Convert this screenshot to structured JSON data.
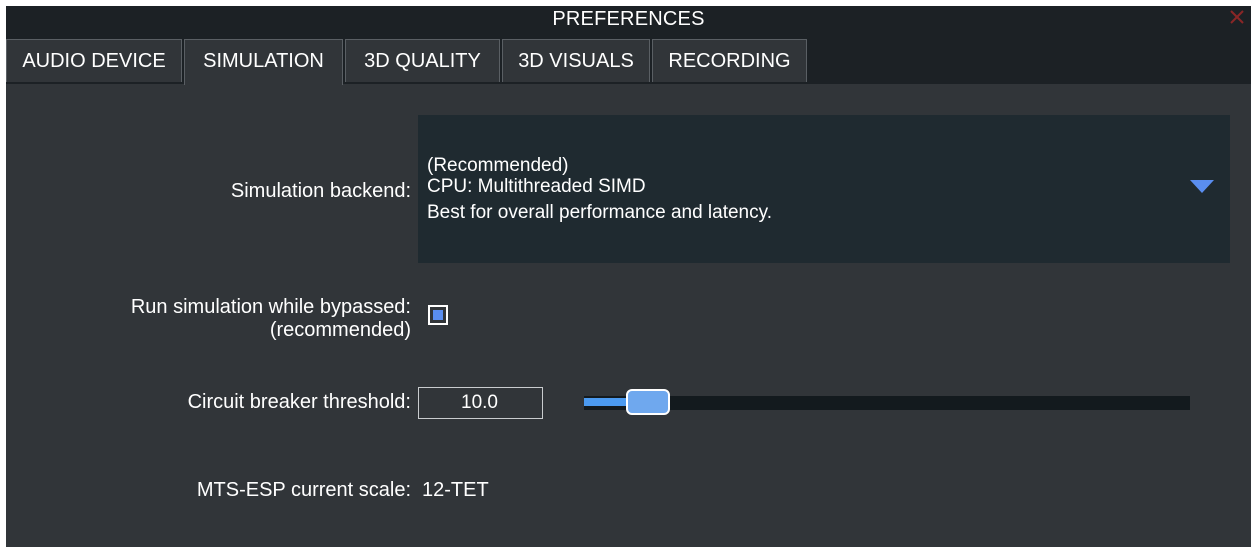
{
  "window": {
    "title": "PREFERENCES",
    "close_icon": "close-x-icon",
    "close_color": "#b02a2a"
  },
  "tabs": [
    {
      "label": "AUDIO DEVICE",
      "active": false
    },
    {
      "label": "SIMULATION",
      "active": true
    },
    {
      "label": "3D QUALITY",
      "active": false
    },
    {
      "label": "3D VISUALS",
      "active": false
    },
    {
      "label": "RECORDING",
      "active": false
    }
  ],
  "simulation": {
    "backend": {
      "label": "Simulation backend:",
      "selected_line1": "(Recommended)",
      "selected_line2": "CPU: Multithreaded SIMD",
      "selected_line3": "Best for overall performance and latency.",
      "arrow_icon": "triangle-down-icon"
    },
    "bypass": {
      "label_line1": "Run simulation while bypassed:",
      "label_line2": "(recommended)",
      "checked": true
    },
    "circuit_breaker": {
      "label": "Circuit breaker threshold:",
      "value": "10.0",
      "slider_fraction": 0.07
    },
    "mts_esp": {
      "label": "MTS-ESP current scale:",
      "value": "12-TET"
    }
  },
  "colors": {
    "background": "#313539",
    "titlebar": "#1c2125",
    "accent": "#5a8ef0",
    "slider_fill": "#4b9af0",
    "dropdown_bg": "#1f2a30"
  }
}
